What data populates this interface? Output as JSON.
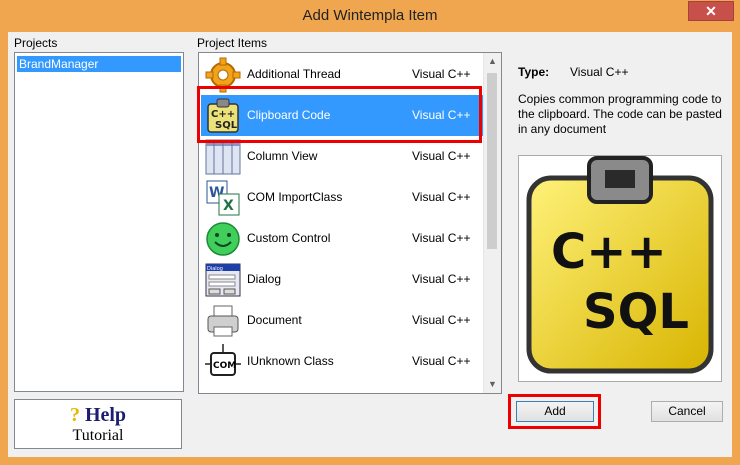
{
  "window": {
    "title": "Add Wintempla Item",
    "close_glyph": "✕"
  },
  "projects": {
    "label": "Projects",
    "items": [
      "BrandManager"
    ]
  },
  "project_items": {
    "label": "Project Items",
    "rows": [
      {
        "name": "Additional Thread",
        "type": "Visual C++",
        "icon": "gear-icon"
      },
      {
        "name": "Clipboard Code",
        "type": "Visual C++",
        "icon": "clipboard-cpp-sql-icon",
        "selected": true
      },
      {
        "name": "Column View",
        "type": "Visual C++",
        "icon": "column-view-icon"
      },
      {
        "name": "COM ImportClass",
        "type": "Visual C++",
        "icon": "word-excel-icon"
      },
      {
        "name": "Custom Control",
        "type": "Visual C++",
        "icon": "smiley-icon"
      },
      {
        "name": "Dialog",
        "type": "Visual C++",
        "icon": "dialog-icon"
      },
      {
        "name": "Document",
        "type": "Visual C++",
        "icon": "printer-icon"
      },
      {
        "name": "IUnknown Class",
        "type": "Visual C++",
        "icon": "com-chip-icon"
      }
    ],
    "icon_texts": {
      "cpp": "C++",
      "sql": "SQL",
      "com": "COM",
      "dialog": "Dialog"
    }
  },
  "details": {
    "type_label": "Type:",
    "type_value": "Visual C++",
    "description": "Copies common programming code to the clipboard. The code can be pasted in any document",
    "preview_icon": "clipboard-cpp-sql-icon",
    "preview_text_1": "C++",
    "preview_text_2": "SQL"
  },
  "help": {
    "line1": "Help",
    "q": "?",
    "line2": "Tutorial"
  },
  "buttons": {
    "add": "Add",
    "cancel": "Cancel"
  },
  "colors": {
    "titlebar": "#f0a64f",
    "selection": "#3399ff",
    "highlight": "#ee0000"
  }
}
